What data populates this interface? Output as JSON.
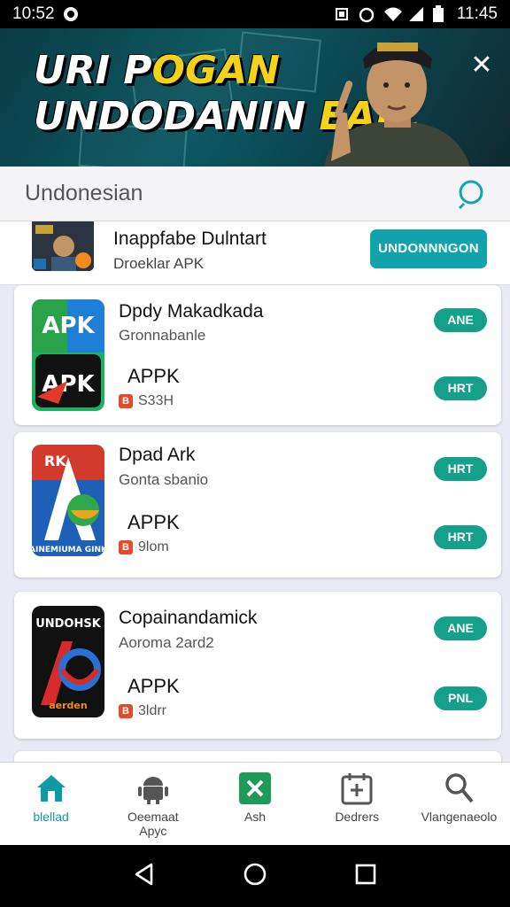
{
  "status_bar": {
    "time_left": "10:52",
    "time_right": "11:45"
  },
  "banner": {
    "headline_line1_white": "URI P",
    "headline_line1_yellow": "OGAN",
    "headline_line2_white": "UNDODANIN ",
    "headline_line2_yellow": "EAR.",
    "close_glyph": "✕"
  },
  "search": {
    "query": "Undonesian",
    "icon": "search-icon"
  },
  "promo": {
    "title": "Inappfabe Dulntart",
    "subtitle": "Droeklar APK",
    "button_label": "UNDONNNGON"
  },
  "apps": [
    {
      "name": "Dpdy Makadkada",
      "developer": "Gronnabanle",
      "kind": "APPK",
      "size": "S33H",
      "button_top": "ANE",
      "button_bottom": "HRT",
      "icon_text_top": "APK",
      "icon_text_bottom": "APK"
    },
    {
      "name": "Dpad Ark",
      "developer": "Gonta sbanio",
      "kind": "APPK",
      "size": "9lom",
      "button_top": "HRT",
      "button_bottom": "HRT",
      "icon_text_top": "RK",
      "icon_text_bottom": "AINEMIUMA GINK"
    },
    {
      "name": "Copainandamick",
      "developer": "Aoroma 2ard2",
      "kind": "APPK",
      "size": "3ldrr",
      "button_top": "ANE",
      "button_bottom": "PNL",
      "icon_text_top": "UNDOHSK",
      "icon_text_bottom": "aerden"
    }
  ],
  "bottom_nav": [
    {
      "label": "blellad",
      "icon": "home-icon",
      "active": true
    },
    {
      "label": "Oeemaat\nApyc",
      "icon": "android-icon",
      "active": false
    },
    {
      "label": "Ash",
      "icon": "close-box-icon",
      "active": false
    },
    {
      "label": "Dedrers",
      "icon": "calendar-icon",
      "active": false
    },
    {
      "label": "Vlangenaeolo",
      "icon": "profile-search-icon",
      "active": false
    }
  ],
  "colors": {
    "accent": "#12a2ab",
    "button_green": "#16a08a",
    "status_bar": "#000000",
    "headline_yellow": "#f3d21a"
  }
}
